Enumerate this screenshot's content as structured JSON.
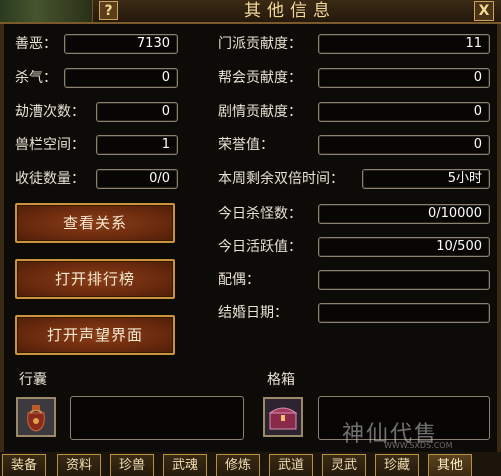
{
  "window": {
    "title": "其他信息",
    "help_label": "?",
    "close_label": "X"
  },
  "left_stats": [
    {
      "label": "善恶：",
      "value": "7130"
    },
    {
      "label": "杀气：",
      "value": "0"
    },
    {
      "label": "劫漕次数：",
      "value": "0"
    },
    {
      "label": "兽栏空间：",
      "value": "1"
    },
    {
      "label": "收徒数量：",
      "value": "0/0"
    }
  ],
  "right_stats": [
    {
      "label": "门派贡献度：",
      "value": "11"
    },
    {
      "label": "帮会贡献度：",
      "value": "0"
    },
    {
      "label": "剧情贡献度：",
      "value": "0"
    },
    {
      "label": "荣誉值：",
      "value": "0"
    },
    {
      "label": "本周剩余双倍时间：",
      "value": "5小时"
    },
    {
      "label": "今日杀怪数：",
      "value": "0/10000"
    },
    {
      "label": "今日活跃值：",
      "value": "10/500"
    },
    {
      "label": "配偶：",
      "value": ""
    },
    {
      "label": "结婚日期：",
      "value": ""
    }
  ],
  "buttons": {
    "view_relations": "查看关系",
    "open_rankings": "打开排行榜",
    "open_reputation": "打开声望界面"
  },
  "bag": {
    "label": "行囊",
    "icon": "bag-icon"
  },
  "box": {
    "label": "格箱",
    "icon": "chest-icon"
  },
  "tabs": [
    "装备",
    "资料",
    "珍兽",
    "武魂",
    "修炼",
    "武道",
    "灵武",
    "珍藏",
    "其他"
  ],
  "active_tab": "其他",
  "watermark": {
    "text": "神仙代售",
    "url": "WWW.SXDS.COM"
  },
  "colors": {
    "gold_border": "#c9943c",
    "button_fill": "#6a2a0e",
    "text": "#e8e2d2"
  }
}
